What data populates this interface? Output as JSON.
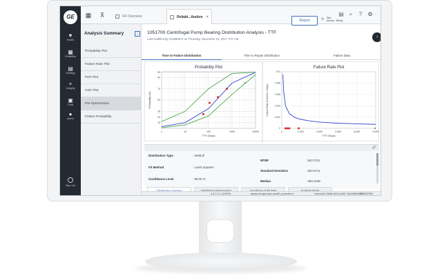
{
  "nav": {
    "logo_text": "GE",
    "items": [
      {
        "label": "Health",
        "icon": "heart-icon",
        "glyph": "♥"
      },
      {
        "label": "Reliability",
        "icon": "grid-icon",
        "glyph": "▦"
      },
      {
        "label": "Strategy",
        "icon": "strategy-icon",
        "glyph": "▤"
      },
      {
        "label": "Integrity",
        "icon": "plus-icon",
        "glyph": "+"
      },
      {
        "label": "Tools",
        "icon": "tools-icon",
        "glyph": "▣"
      },
      {
        "label": "Admin",
        "icon": "user-icon",
        "glyph": "●"
      }
    ],
    "sign_out": "Sign Out"
  },
  "topbar": {
    "home_glyph": "▦",
    "tree_glyph": "⊼",
    "tabs": [
      {
        "label": "R4 Overview",
        "active": false
      },
      {
        "label": "Reliabi...tbution",
        "active": true
      }
    ],
    "close_glyph": "×",
    "right_icons": [
      "clipboard-icon",
      "search-icon",
      "help-icon",
      "settings-icon"
    ],
    "right_glyphs": [
      "▤",
      "⌕",
      "?",
      "✿"
    ]
  },
  "side": {
    "title": "Analysis Summary",
    "collapse_glyph": "‹",
    "items": [
      {
        "label": "Probability Plot",
        "selected": false
      },
      {
        "label": "Failure Rate Plot",
        "selected": false
      },
      {
        "label": "PDF Plot",
        "selected": false
      },
      {
        "label": "CDF Plot",
        "selected": false
      },
      {
        "label": "PM Optimization",
        "selected": true
      },
      {
        "label": "Failure Probability",
        "selected": false
      }
    ]
  },
  "main": {
    "title": "1051700 Centrifugal Pump Bearing Distribution Analysis - TTF",
    "subtitle": "Last modified by 212690674 on Thursday, November 16, 2017 7:07 AM",
    "report_label": "Report",
    "site_line1": "Site:",
    "site_line2": "Alexan...Bning",
    "fab_glyph": "›",
    "content_tabs": [
      "Time to Failure Distribution",
      "Time to Repair Distribution",
      "Failure Data"
    ]
  },
  "details": {
    "link_glyph": "🔗",
    "left": [
      {
        "label": "Distribution Type",
        "value": ": Weibull"
      },
      {
        "label": "Fit Method",
        "value": ": Least Squares"
      },
      {
        "label": "Confidence Level",
        "value": ": 90.00 %"
      }
    ],
    "right": [
      {
        "label": "MTBF",
        "value": ": 503.7012"
      },
      {
        "label": "Standard Deviation",
        "value": ": 502.5711"
      },
      {
        "label": "Median",
        "value": ": 250.3168"
      }
    ]
  },
  "bottom_tabs": [
    "Distribution Options",
    "Distribution Parameters",
    "Goodness of Fit Test",
    "Analysis Basis"
  ],
  "status": {
    "version": "4.3.0.2.1 (10229)",
    "host": "apmprod.app.aws-usw02-pr.predix.io",
    "tenant": "1eeccc51-06d5-4810-be35-75c1b6f9d9b0",
    "user": "212587950"
  },
  "chart_data": [
    {
      "type": "line",
      "title": "Probability Plot",
      "xlabel": "TTF (Days)",
      "ylabel": "Probability (%)",
      "x_scale": "log",
      "xlim": [
        1,
        10000
      ],
      "x_ticks": [
        1,
        10,
        100,
        1000,
        10000
      ],
      "y_ticks": [
        99,
        90,
        70,
        50,
        30,
        20,
        10
      ],
      "grid": true,
      "series": [
        {
          "color": "#3344cc",
          "x": [
            1,
            10,
            100,
            1000,
            10000
          ],
          "y": [
            3,
            10,
            35,
            80,
            99
          ]
        },
        {
          "color": "#4aa84a",
          "x": [
            1,
            10,
            100,
            1000,
            10000
          ],
          "y": [
            1,
            6,
            22,
            60,
            95
          ]
        },
        {
          "color": "#4aa84a",
          "x": [
            1,
            10,
            100,
            1000,
            10000
          ],
          "y": [
            12,
            30,
            70,
            97,
            99
          ]
        }
      ],
      "points": {
        "color": "#d42a2a",
        "x": [
          60,
          110,
          250,
          600
        ],
        "y": [
          25,
          45,
          55,
          70
        ]
      },
      "censored_mark": {
        "glyph": "×",
        "x": 3500,
        "y": 80
      }
    },
    {
      "type": "line",
      "title": "Failure Rate Plot",
      "xlabel": "TTF (Days)",
      "ylabel": "Failure Rate (Failures / Days)",
      "xlim": [
        0,
        5000
      ],
      "x_ticks": [
        0,
        1000,
        2000,
        3000,
        4000,
        5000
      ],
      "x_tick_labels": [
        "0",
        "1,000",
        "2,000",
        "3,000",
        "4,000",
        "5,000"
      ],
      "y_ticks": [
        0,
        0.002,
        0.004,
        0.006,
        0.008,
        0.01
      ],
      "ylim": [
        0,
        0.01
      ],
      "grid": true,
      "series": [
        {
          "color": "#3344cc",
          "x": [
            60,
            100,
            200,
            400,
            700,
            1000,
            1500,
            2000,
            3000,
            4000,
            5000
          ],
          "y": [
            0.0095,
            0.0065,
            0.004,
            0.0026,
            0.0019,
            0.0016,
            0.0013,
            0.0011,
            0.0009,
            0.0008,
            0.0007
          ]
        }
      ],
      "points": {
        "color": "#d42a2a",
        "x": [
          200,
          300,
          400,
          900
        ],
        "y": [
          0,
          0,
          0,
          0
        ]
      },
      "censored_mark": {
        "glyph": "×",
        "x": 5000,
        "y": 0
      }
    }
  ]
}
